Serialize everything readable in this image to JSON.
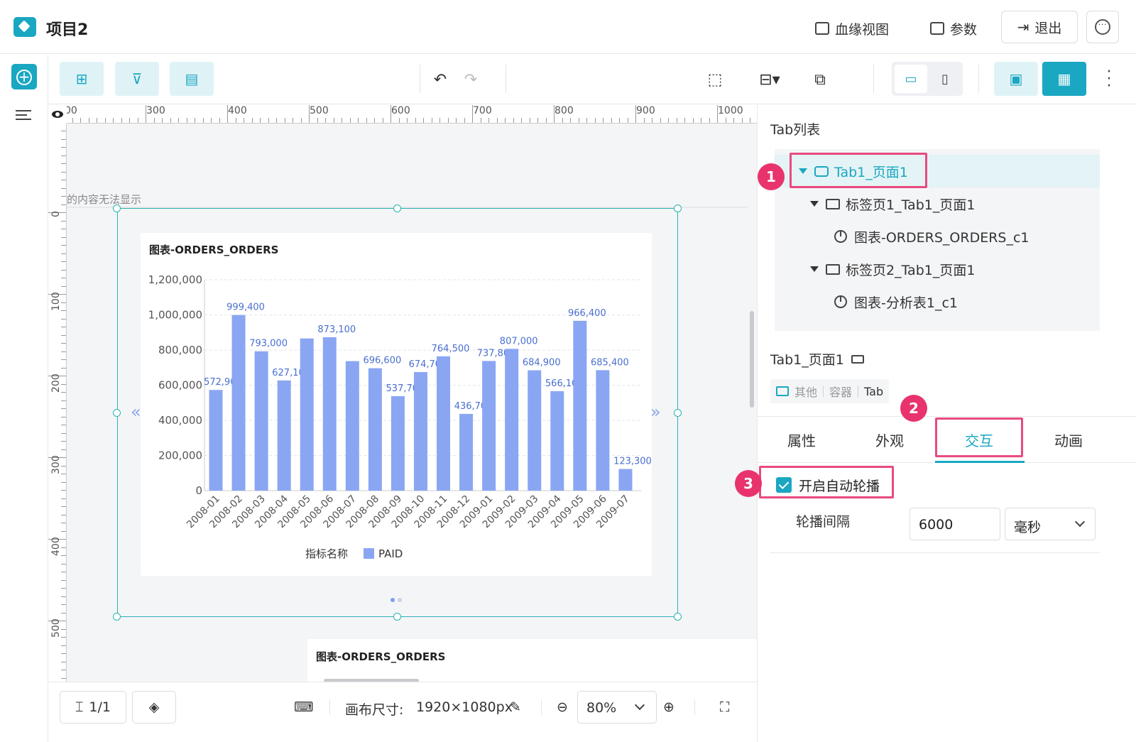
{
  "header": {
    "project_title": "项目2",
    "lineage_label": "血缘视图",
    "params_label": "参数",
    "exit_label": "退出"
  },
  "toolbar": {
    "icons": [
      "add-page-icon",
      "add-filter-icon",
      "add-component-icon",
      "undo-icon",
      "redo-icon",
      "select-icon",
      "align-icon",
      "layout-icon",
      "desktop-icon",
      "mobile-icon",
      "preview-icon",
      "save-icon",
      "more-vertical-icon"
    ]
  },
  "ruler": {
    "h_labels": [
      "00",
      "300",
      "400",
      "500",
      "600",
      "700",
      "800",
      "900",
      "1000"
    ],
    "v_labels": [
      "0",
      "100",
      "200",
      "300",
      "400",
      "500"
    ]
  },
  "canvas": {
    "overflow_message": "的内容无法显示",
    "second_chart_title": "图表-ORDERS_ORDERS"
  },
  "chart_data": {
    "type": "bar",
    "title": "图表-ORDERS_ORDERS",
    "categories": [
      "2008-01",
      "2008-02",
      "2008-03",
      "2008-04",
      "2008-05",
      "2008-06",
      "2008-07",
      "2008-08",
      "2008-09",
      "2008-10",
      "2008-11",
      "2008-12",
      "2009-01",
      "2009-02",
      "2009-03",
      "2009-04",
      "2009-05",
      "2009-06",
      "2009-07"
    ],
    "series": [
      {
        "name": "PAID",
        "values": [
          572900,
          999400,
          793000,
          627100,
          866000,
          873100,
          737000,
          696600,
          537700,
          674700,
          764500,
          436700,
          737800,
          807000,
          684900,
          566100,
          966400,
          685400,
          123300
        ]
      }
    ],
    "data_labels": [
      "572,900",
      "999,400",
      "793,000",
      "627,100",
      "",
      "873,100",
      "",
      "696,600",
      "537,700",
      "674,700",
      "764,500",
      "436,700",
      "737,800",
      "807,000",
      "684,900",
      "566,100",
      "966,400",
      "685,400",
      "123,300"
    ],
    "y_ticks": [
      "0",
      "200,000",
      "400,000",
      "600,000",
      "800,000",
      "1,000,000",
      "1,200,000"
    ],
    "y_tick_values": [
      0,
      200000,
      400000,
      600000,
      800000,
      1000000,
      1200000
    ],
    "ylim": [
      0,
      1200000
    ],
    "legend_title": "指标名称",
    "legend_position": "bottom",
    "grid": true,
    "bar_color": "#8aa6f3"
  },
  "bottombar": {
    "page_count": "1/1",
    "canvas_size_label": "画布尺寸:",
    "canvas_size_value": "1920×1080px",
    "zoom": "80%"
  },
  "panel": {
    "tab_list_title": "Tab列表",
    "tree": [
      {
        "label": "Tab1_页面1",
        "selected": true
      },
      {
        "label": "标签页1_Tab1_页面1"
      },
      {
        "label": "图表-ORDERS_ORDERS_c1"
      },
      {
        "label": "标签页2_Tab1_页面1"
      },
      {
        "label": "图表-分析表1_c1"
      }
    ],
    "component_name": "Tab1_页面1",
    "type_tags": [
      "其他",
      "容器",
      "Tab"
    ],
    "tabs": [
      "属性",
      "外观",
      "交互",
      "动画"
    ],
    "active_tab": "交互",
    "autoplay_label": "开启自动轮播",
    "autoplay_checked": true,
    "interval_label": "轮播间隔",
    "interval_value": "6000",
    "interval_unit": "毫秒",
    "badges": [
      "1",
      "2",
      "3"
    ]
  },
  "colors": {
    "accent": "#1aa7c2",
    "highlight": "#e84a7f",
    "badge": "#e8336d"
  }
}
